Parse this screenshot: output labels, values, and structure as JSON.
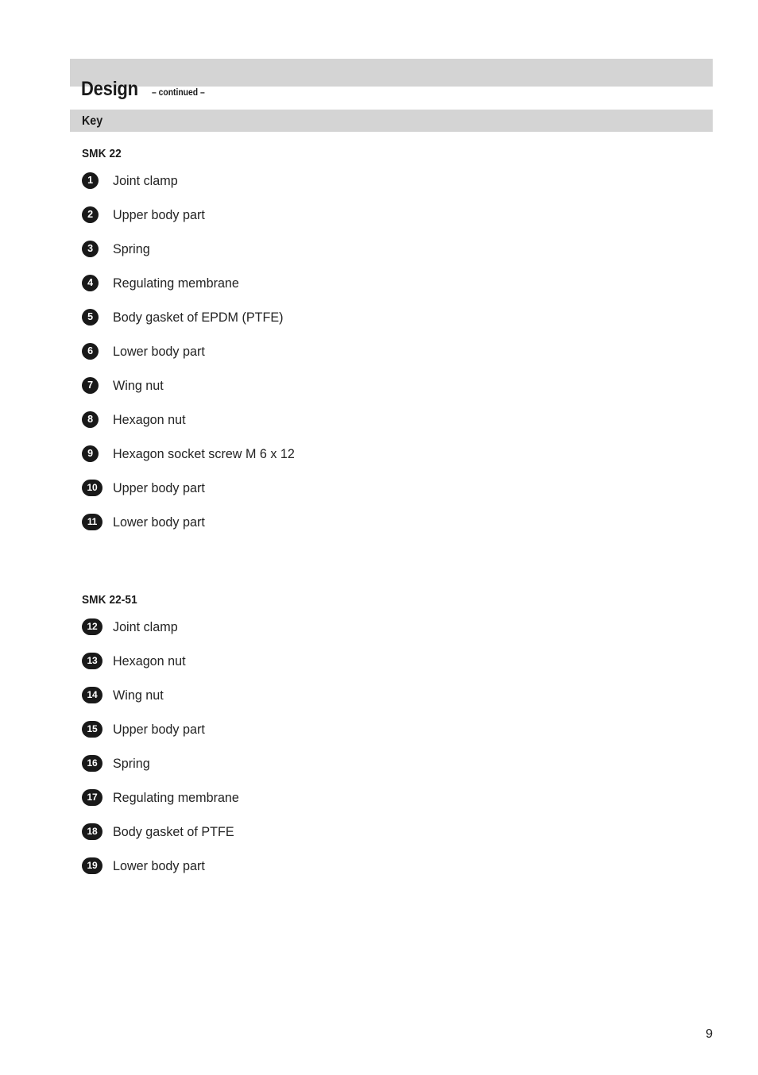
{
  "header": {
    "title": "Design",
    "subtitle": "– continued –"
  },
  "key_bar": {
    "label": "Key"
  },
  "groups": [
    {
      "heading": "SMK 22",
      "items": [
        {
          "number": "1",
          "label": "Joint clamp"
        },
        {
          "number": "2",
          "label": "Upper body part"
        },
        {
          "number": "3",
          "label": "Spring"
        },
        {
          "number": "4",
          "label": "Regulating membrane"
        },
        {
          "number": "5",
          "label": "Body gasket of EPDM (PTFE)"
        },
        {
          "number": "6",
          "label": "Lower body part"
        },
        {
          "number": "7",
          "label": "Wing nut"
        },
        {
          "number": "8",
          "label": "Hexagon nut"
        },
        {
          "number": "9",
          "label": "Hexagon socket screw M 6 x 12"
        },
        {
          "number": "10",
          "label": "Upper body part"
        },
        {
          "number": "11",
          "label": "Lower body part"
        }
      ]
    },
    {
      "heading": "SMK 22-51",
      "items": [
        {
          "number": "12",
          "label": "Joint clamp"
        },
        {
          "number": "13",
          "label": "Hexagon nut"
        },
        {
          "number": "14",
          "label": "Wing nut"
        },
        {
          "number": "15",
          "label": "Upper body part"
        },
        {
          "number": "16",
          "label": "Spring"
        },
        {
          "number": "17",
          "label": "Regulating membrane"
        },
        {
          "number": "18",
          "label": "Body gasket of PTFE"
        },
        {
          "number": "19",
          "label": "Lower body part"
        }
      ]
    }
  ],
  "footer": {
    "page_number": "9"
  },
  "colors": {
    "bar_gray": "#d4d4d4",
    "badge_black": "#191919",
    "text": "#232323",
    "background": "#ffffff"
  }
}
